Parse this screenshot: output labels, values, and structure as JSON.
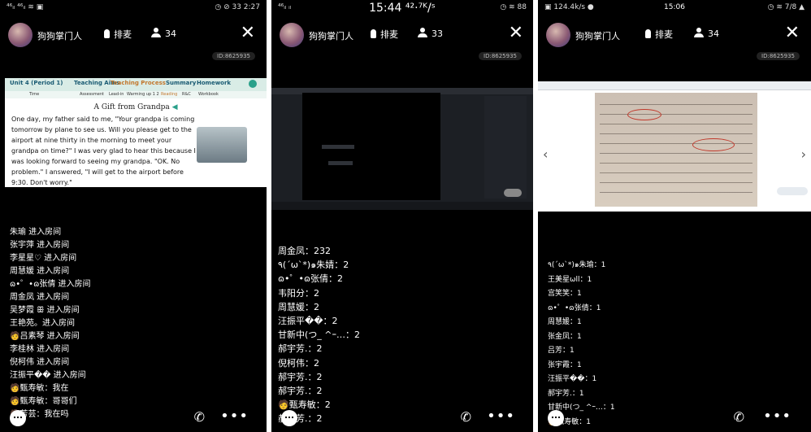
{
  "panels": [
    {
      "status": {
        "left": "⁴⁶ᵢₗ ⁴⁶ᵢₗ ≋ ▣",
        "center": "",
        "right": "◷ ⊘ 33 2:27"
      },
      "header": {
        "anchor": "狗狗掌门人",
        "mic": "排麦",
        "users": "34",
        "room_id": "ID:8625935"
      },
      "slide": {
        "unit": "Unit 4 (Period 1)",
        "teaching_aims": "Teaching Aims",
        "teaching_process": "Teaching Process",
        "summary": "Summary",
        "homework": "Homework",
        "sub": [
          "Time",
          "Assessment",
          "Lead-in",
          "Warming up 1 2",
          "Reading",
          "R&C",
          "Workbook"
        ],
        "title": "A Gift from Grandpa",
        "text": "One day, my father said to me, \"Your grandpa is coming tomorrow by plane to see us. Will you please get to the airport at nine thirty in the morning to meet your grandpa on time?\" I was very glad to hear this because I was looking forward to seeing my grandpa. \"OK. No problem.\" I answered, \"I will get to the airport before 9:30. Don't worry.\""
      },
      "chat": [
        "朱瑜 进入房间",
        "张宇萍 进入房间",
        "李星星♡ 进入房间",
        "周慧媛 进入房间",
        "ɷ•゜•ɷ张倩 进入房间",
        "周金凤 进入房间",
        "吴梦霞 ꕥ 进入房间",
        "王艳苑。进入房间",
        "🧑吕素琴 进入房间",
        "李桂林 进入房间",
        "倪柯伟 进入房间",
        "汪振平�� 进入房间",
        "🧑甄寿敏：我在",
        "🧑甄寿敏：哥哥们",
        "🧑芳芸：我在吗"
      ]
    },
    {
      "status": {
        "left": "⁴⁶ᵢₗ ᵢₗ",
        "center": "15:44 ⁴²·⁷ᴷ/ˢ",
        "right": "◷ ≋ 88"
      },
      "header": {
        "anchor": "狗狗掌门人",
        "mic": "排麦",
        "users": "33",
        "room_id": "ID:8625935"
      },
      "chat": [
        "周金凤：232",
        "٩(´ω`*)๑朱婧：2",
        "ɷ•゜•ɷ张倩：2",
        "韦阳分：2",
        "周慧媛：2",
        "汪振平��：2",
        "甘新中(つ_ ^ｰ…：2",
        "郝宇芳.：2",
        "倪柯伟：2",
        "郝宇芳.：2",
        "郝宇芳.：2",
        "🧑甄寿敏：2",
        "郝宇芳.：2"
      ]
    },
    {
      "status": {
        "left": "▣ 124.4k/s ●",
        "center": "15:06",
        "right": "◷ ≋ 7/8 ▲"
      },
      "header": {
        "anchor": "狗狗掌门人",
        "mic": "排麦",
        "users": "34",
        "room_id": "ID:8625935"
      },
      "chat": [
        "٩(´ω`*)๑朱瑜：1",
        "王美星ωll：1",
        "宫笑笑：1",
        "ɷ•゜•ɷ张倩：1",
        "周慧媛：1",
        "张金凤：1",
        "吕芳：1",
        "张宇霞：1",
        "汪振平��：1",
        "郝宇芳.：1",
        "甘新中(つ_ ^ｰ…：1",
        "🧑甄寿敏：1"
      ]
    }
  ],
  "icons": {
    "mic": "mic-icon",
    "users": "user-icon",
    "close": "close-icon",
    "chat": "chat-icon",
    "call": "phone-icon",
    "more": "more-icon",
    "speaker": "speaker-icon",
    "home": "home-icon"
  }
}
